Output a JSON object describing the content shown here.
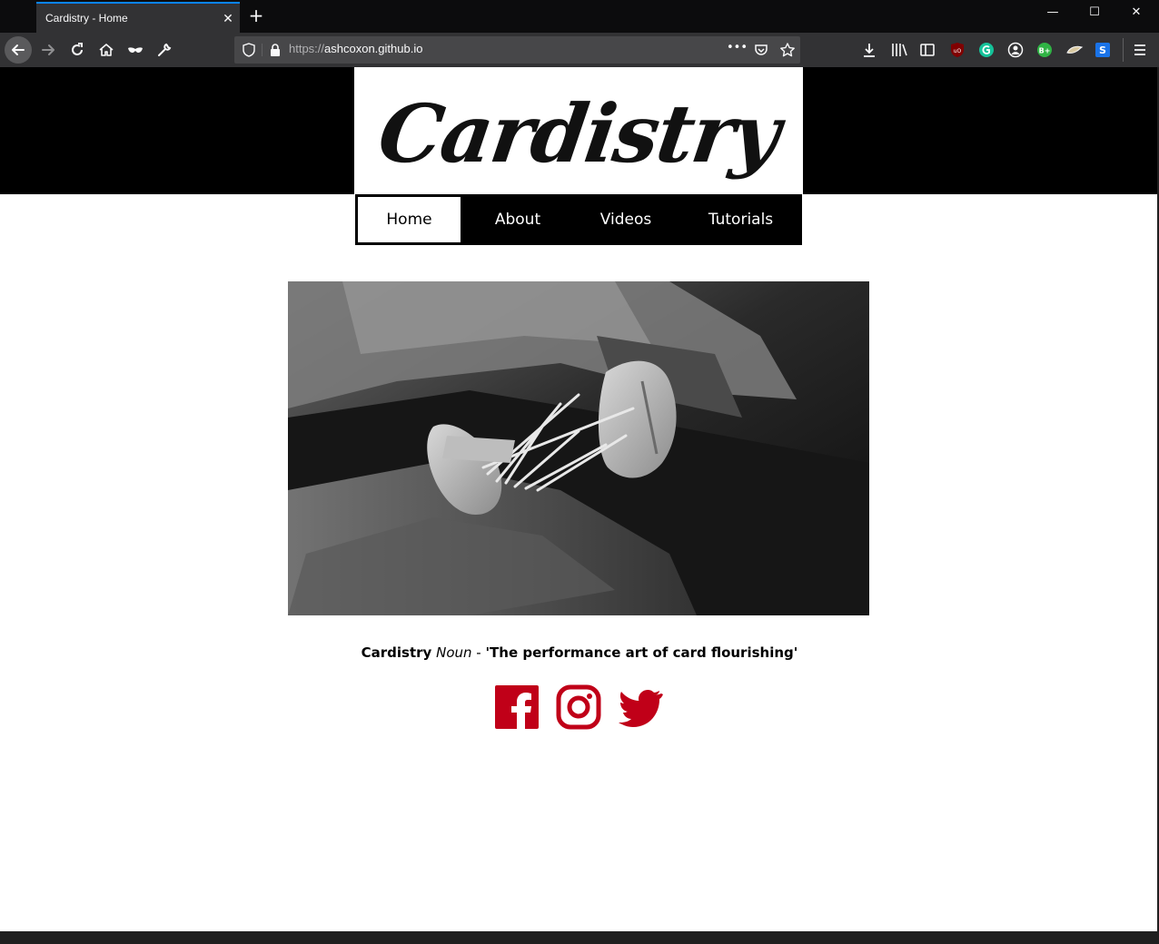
{
  "browser": {
    "tab_title": "Cardistry - Home",
    "tab_close": "✕",
    "new_tab": "+",
    "url_scheme": "https://",
    "url_host": "ashcoxon.github.io",
    "page_actions": "•••",
    "window_minimize": "—",
    "window_maximize": "☐",
    "window_close": "✕"
  },
  "site": {
    "logo_text": "Cardistry",
    "nav": [
      {
        "label": "Home",
        "active": true
      },
      {
        "label": "About",
        "active": false
      },
      {
        "label": "Videos",
        "active": false
      },
      {
        "label": "Tutorials",
        "active": false
      }
    ],
    "tagline": {
      "word": "Cardistry",
      "pos": "Noun",
      "dash": " - ",
      "definition": "'The performance art of card flourishing'"
    },
    "social_color": "#c00018",
    "socials": [
      "facebook-icon",
      "instagram-icon",
      "twitter-icon"
    ]
  }
}
